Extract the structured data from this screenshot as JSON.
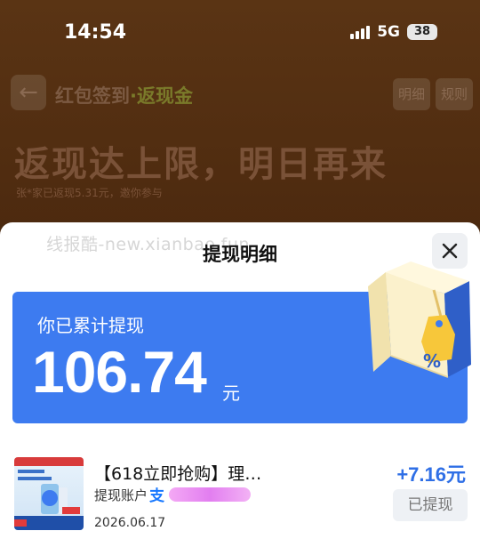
{
  "status_bar": {
    "time": "14:54",
    "network": "5G",
    "battery": "38"
  },
  "background": {
    "nav_title": "红包签到",
    "nav_title_sep": "·",
    "nav_title_accent": "返现金",
    "detail_chip": "明细",
    "rules_chip": "规则",
    "headline": "返现达上限，明日再来",
    "subtext": "张*家已返现5.31元，邀你参与"
  },
  "sheet": {
    "title": "提现明细",
    "watermark": "线报酷-new.xianbao.fun",
    "summary_label": "你已累计提现",
    "summary_amount": "106.74",
    "summary_unit": "元",
    "badge_symbol": "%"
  },
  "records": [
    {
      "title": "【618立即抢购】理…",
      "account_label": "提现账户",
      "account_icon": "支",
      "date": "2026.06.17",
      "amount": "+7.16元",
      "status": "已提现"
    }
  ],
  "colors": {
    "accent_blue": "#3d7bf0",
    "amount_blue": "#2f6fe6",
    "bg_brown": "#4d2a0f"
  }
}
